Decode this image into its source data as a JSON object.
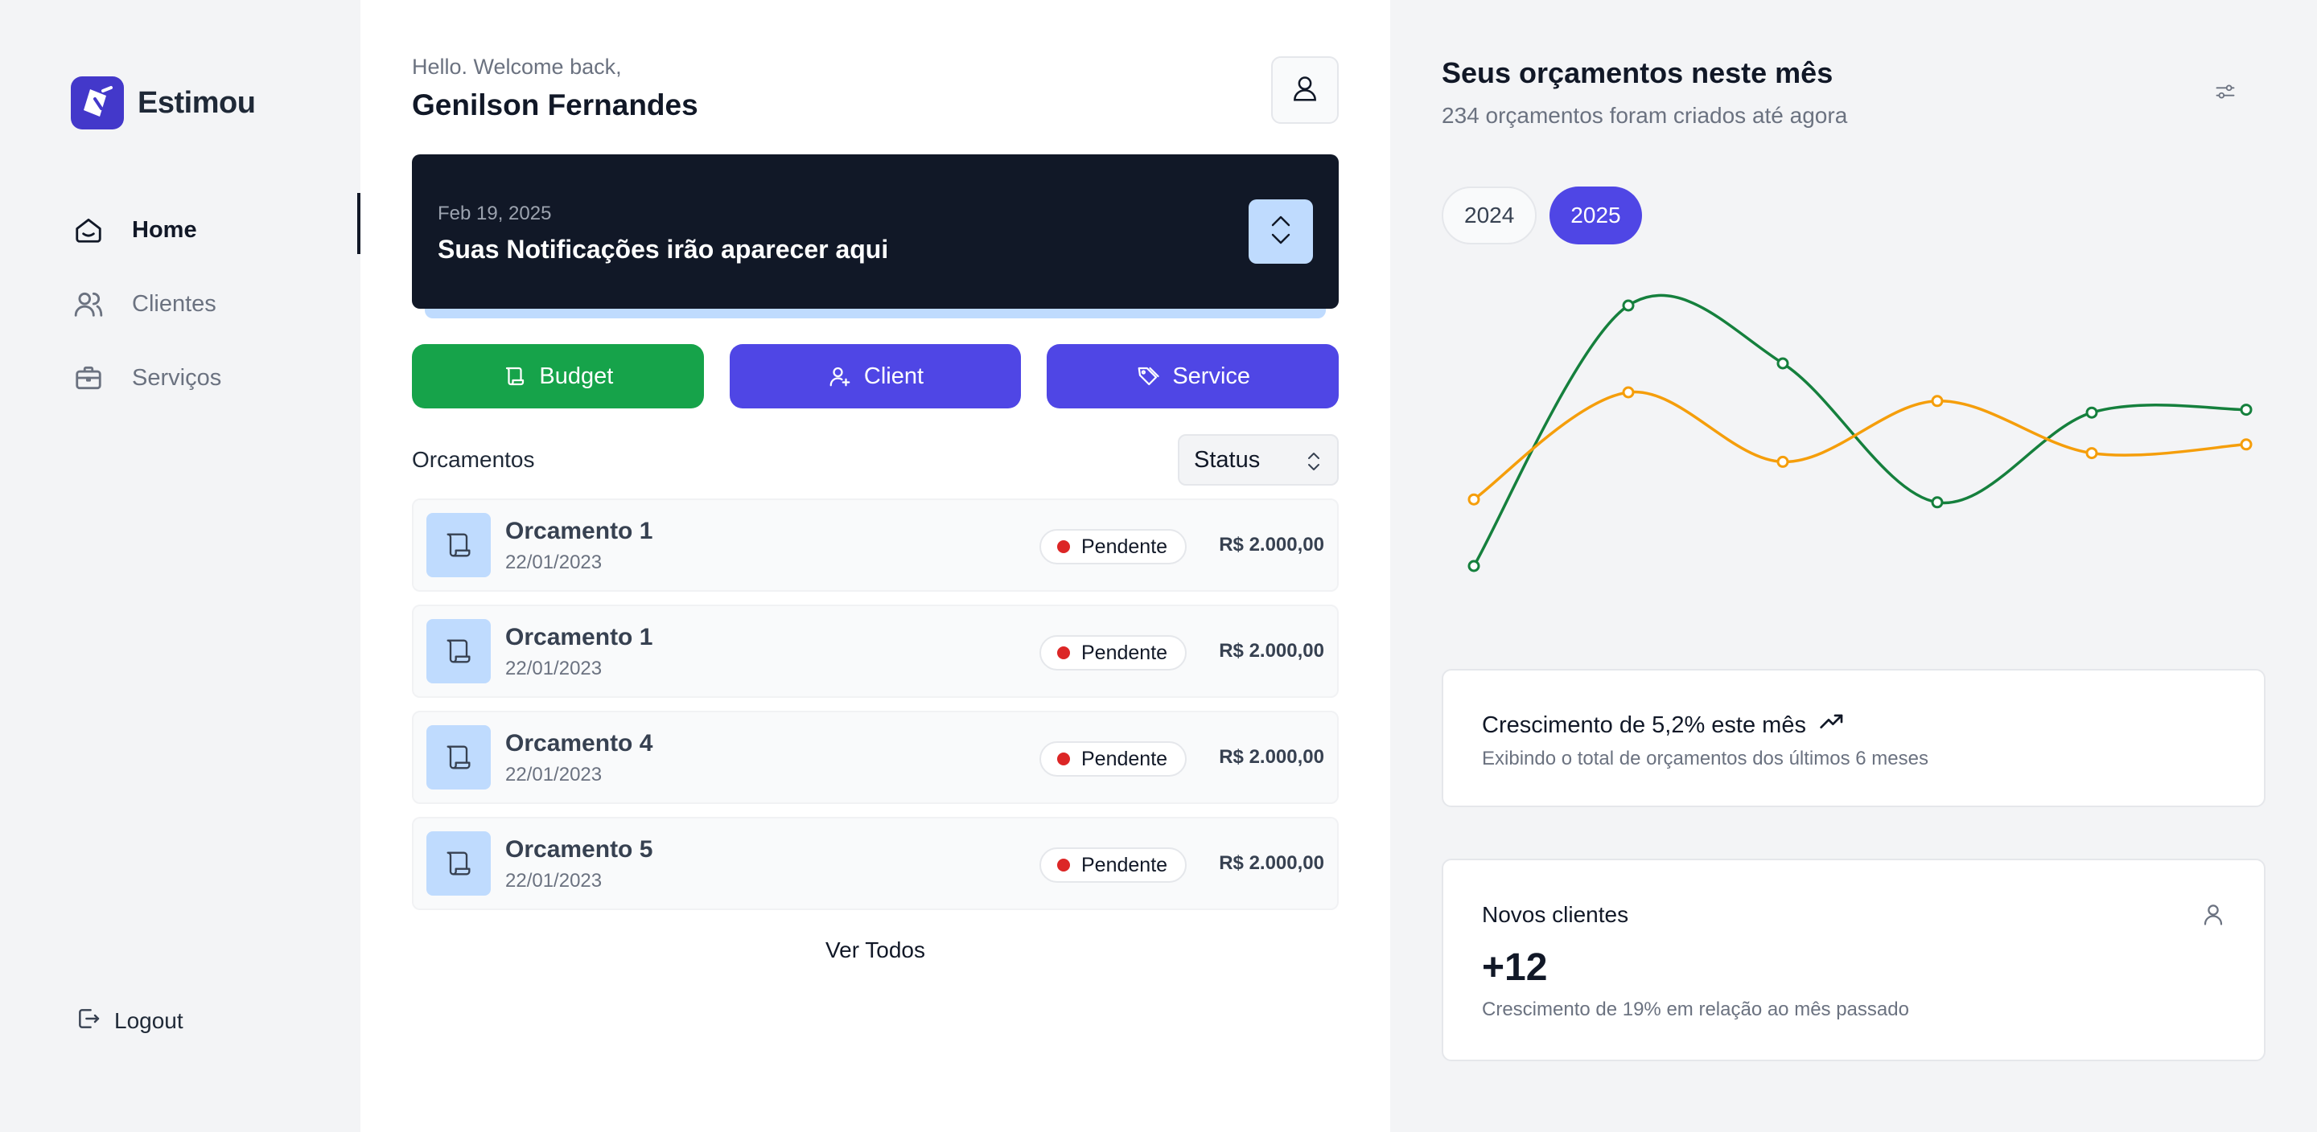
{
  "app": {
    "name": "Estimou"
  },
  "sidebar": {
    "items": [
      {
        "label": "Home",
        "icon": "home-icon",
        "active": true
      },
      {
        "label": "Clientes",
        "icon": "users-icon",
        "active": false
      },
      {
        "label": "Serviços",
        "icon": "briefcase-icon",
        "active": false
      }
    ],
    "logout_label": "Logout"
  },
  "header": {
    "greeting": "Hello. Welcome back,",
    "user_name": "Genilson Fernandes"
  },
  "notification": {
    "date": "Feb 19, 2025",
    "title": "Suas Notificações irão aparecer aqui"
  },
  "actions": {
    "budget_label": "Budget",
    "client_label": "Client",
    "service_label": "Service"
  },
  "list": {
    "title": "Orcamentos",
    "status_select": "Status",
    "see_all": "Ver Todos",
    "rows": [
      {
        "title": "Orcamento 1",
        "date": "22/01/2023",
        "status": "Pendente",
        "amount": "R$ 2.000,00"
      },
      {
        "title": "Orcamento 1",
        "date": "22/01/2023",
        "status": "Pendente",
        "amount": "R$ 2.000,00"
      },
      {
        "title": "Orcamento 4",
        "date": "22/01/2023",
        "status": "Pendente",
        "amount": "R$ 2.000,00"
      },
      {
        "title": "Orcamento 5",
        "date": "22/01/2023",
        "status": "Pendente",
        "amount": "R$ 2.000,00"
      }
    ]
  },
  "panel": {
    "title": "Seus orçamentos neste mês",
    "subtitle": "234 orçamentos foram criados até agora",
    "years": [
      "2024",
      "2025"
    ],
    "selected_year": "2025"
  },
  "chart_data": {
    "type": "line",
    "x": [
      1,
      2,
      3,
      4,
      5,
      6
    ],
    "xlim": [
      1,
      6
    ],
    "ylim": [
      0,
      100
    ],
    "grid": false,
    "series": [
      {
        "values": [
          10,
          100,
          80,
          32,
          63,
          64
        ],
        "color": "#15803d"
      },
      {
        "values": [
          33,
          70,
          46,
          67,
          49,
          52
        ],
        "color": "#f59e0b"
      }
    ]
  },
  "growth_card": {
    "title": "Crescimento de 5,2% este mês",
    "subtitle": "Exibindo o total de orçamentos dos últimos 6 meses"
  },
  "clients_card": {
    "title": "Novos clientes",
    "value": "+12",
    "subtitle": "Crescimento de 19% em relação ao mês passado"
  },
  "colors": {
    "accent": "#4f46e5",
    "success": "#16a34a",
    "dark": "#111827",
    "light_blue": "#bfdbfe",
    "pending": "#dc2626"
  }
}
